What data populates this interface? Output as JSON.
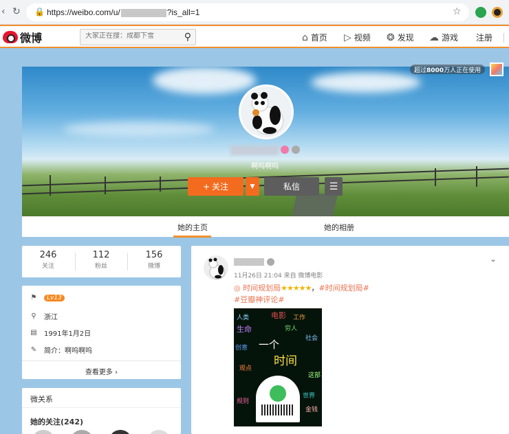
{
  "browser": {
    "url_prefix": "https://weibo.com/u/",
    "url_suffix": "?is_all=1"
  },
  "nav": {
    "logo_text": "微博",
    "search_placeholder": "大家正在搜：成都下雪",
    "items": [
      {
        "label": "首页",
        "icon": "home-icon"
      },
      {
        "label": "视频",
        "icon": "play-icon"
      },
      {
        "label": "发现",
        "icon": "compass-icon"
      },
      {
        "label": "游戏",
        "icon": "gamepad-icon"
      }
    ],
    "register": "注册"
  },
  "cover": {
    "online_badge_pre": "超过",
    "online_badge_num": "8000",
    "online_badge_post": "万人正在使用",
    "bio": "啊呜啊呜"
  },
  "actions": {
    "follow": "关注",
    "message": "私信"
  },
  "tabs": [
    {
      "label": "她的主页",
      "active": true
    },
    {
      "label": "她的相册",
      "active": false
    }
  ],
  "stats": [
    {
      "value": "246",
      "label": "关注"
    },
    {
      "value": "112",
      "label": "粉丝"
    },
    {
      "value": "156",
      "label": "微博"
    }
  ],
  "info": {
    "level": "Lv13",
    "location": "浙江",
    "birthday": "1991年1月2日",
    "intro_label": "简介：",
    "intro": "啊呜啊呜",
    "more": "查看更多"
  },
  "relations": {
    "title": "微关系",
    "following": "她的关注(242)"
  },
  "post": {
    "meta": "11月26日 21:04 来自 微博电影",
    "hashtag1": "时间规划局",
    "stars": "★★★★★",
    "hashtag2": "#时间规划局#",
    "hashtag3": "#豆瓣神评论#",
    "poster_words": [
      "人类",
      "工作",
      "电影",
      "穷人",
      "一个",
      "时间",
      "生命",
      "社会",
      "世界",
      "金钱",
      "这部",
      "观点",
      "创意",
      "规则"
    ]
  },
  "colors": {
    "orange": "#f26b1e",
    "nav_accent": "#f28e2b",
    "link": "#eb7350",
    "dark_btn": "#5d5d5d"
  }
}
